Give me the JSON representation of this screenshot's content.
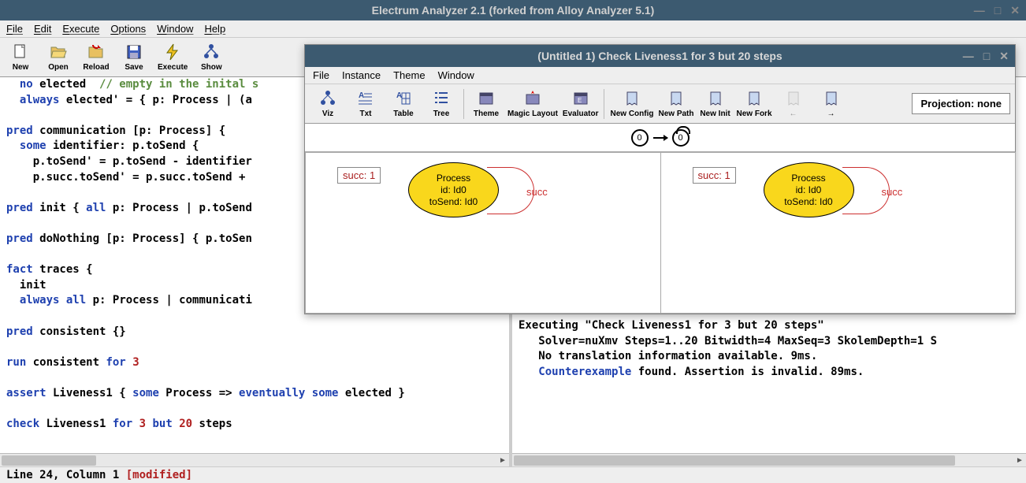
{
  "app": {
    "title": "Electrum Analyzer 2.1 (forked from Alloy Analyzer 5.1)",
    "menu": [
      "File",
      "Edit",
      "Execute",
      "Options",
      "Window",
      "Help"
    ],
    "toolbar": [
      {
        "id": "new",
        "label": "New"
      },
      {
        "id": "open",
        "label": "Open"
      },
      {
        "id": "reload",
        "label": "Reload"
      },
      {
        "id": "save",
        "label": "Save"
      },
      {
        "id": "execute",
        "label": "Execute"
      },
      {
        "id": "show",
        "label": "Show"
      }
    ]
  },
  "editor": {
    "code_raw": "  no elected  // empty in the inital s\n  always elected' = { p: Process | (a\n\npred communication [p: Process] {\n  some identifier: p.toSend {\n    p.toSend' = p.toSend - identifier\n    p.succ.toSend' = p.succ.toSend + \n\npred init { all p: Process | p.toSend\n\npred doNothing [p: Process] { p.toSen\n\nfact traces {\n  init\n  always all p: Process | communicati\n\npred consistent {}\n\nrun consistent for 3\n\nassert Liveness1 { some Process => eventually some elected }\n\ncheck Liveness1 for 3 but 20 steps"
  },
  "output": {
    "line1": "Executing \"Check Liveness1 for 3 but 20 steps\"",
    "line2": "   Solver=nuXmv Steps=1..20 Bitwidth=4 MaxSeq=3 SkolemDepth=1 S",
    "line3": "   No translation information available. 9ms.",
    "line4a": "   ",
    "link": "Counterexample",
    "line4b": " found. Assertion is invalid. 89ms."
  },
  "statusbar": {
    "pos": "Line 24, Column 1 ",
    "mod": "[modified]"
  },
  "viz": {
    "title": "(Untitled 1) Check Liveness1 for 3 but 20 steps",
    "menu": [
      "File",
      "Instance",
      "Theme",
      "Window"
    ],
    "toolbar": [
      {
        "id": "viz",
        "label": "Viz"
      },
      {
        "id": "txt",
        "label": "Txt"
      },
      {
        "id": "table",
        "label": "Table"
      },
      {
        "id": "tree",
        "label": "Tree"
      },
      {
        "id": "theme",
        "label": "Theme"
      },
      {
        "id": "magic",
        "label": "Magic Layout"
      },
      {
        "id": "eval",
        "label": "Evaluator"
      },
      {
        "id": "newcfg",
        "label": "New Config"
      },
      {
        "id": "newpath",
        "label": "New Path"
      },
      {
        "id": "newinit",
        "label": "New Init"
      },
      {
        "id": "newfork",
        "label": "New Fork"
      },
      {
        "id": "left",
        "label": "←"
      },
      {
        "id": "right",
        "label": "→"
      }
    ],
    "projection": "Projection: none",
    "states": [
      "0",
      "0"
    ],
    "pane": {
      "succ_label": "succ: 1",
      "node_title": "Process",
      "node_l1": "id: Id0",
      "node_l2": "toSend: Id0",
      "loop_label": "succ"
    }
  }
}
